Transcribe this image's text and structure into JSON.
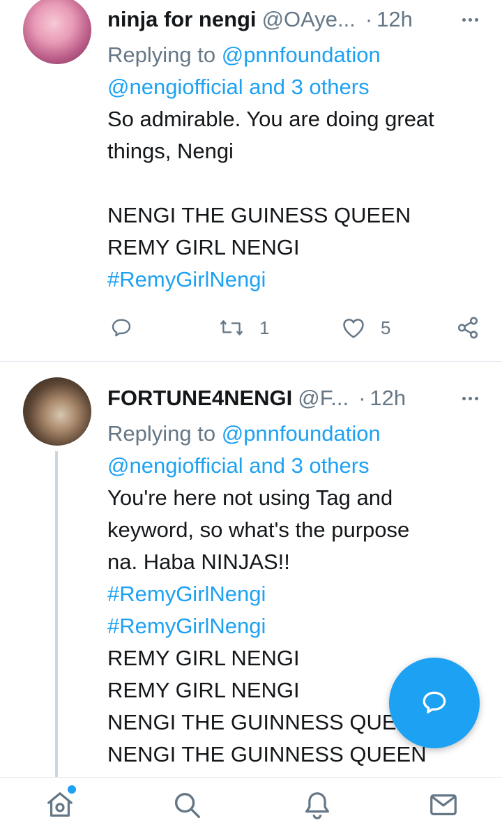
{
  "tweets": [
    {
      "display_name": "ninja for nengi",
      "handle": "@OAye...",
      "separator": "·",
      "time": "12h",
      "replying_prefix": "Replying to",
      "mention_primary": "@pnnfoundation",
      "mention_secondary": "@nengiofficial and 3 others",
      "lines": [
        {
          "type": "text",
          "value": "So admirable. You are doing great"
        },
        {
          "type": "text",
          "value": "things, Nengi"
        },
        {
          "type": "blank",
          "value": ""
        },
        {
          "type": "text",
          "value": "NENGI THE GUINESS QUEEN"
        },
        {
          "type": "text",
          "value": "REMY GIRL NENGI"
        },
        {
          "type": "hashtag",
          "value": "#RemyGirlNengi"
        }
      ],
      "actions": {
        "reply_icon": "reply-icon",
        "retweet_icon": "retweet-icon",
        "retweet_count": "1",
        "like_icon": "heart-icon",
        "like_count": "5",
        "share_icon": "share-icon"
      }
    },
    {
      "display_name": "FORTUNE4NENGI",
      "handle": "@F...",
      "separator": "·",
      "time": "12h",
      "replying_prefix": "Replying to",
      "mention_primary": "@pnnfoundation",
      "mention_secondary": "@nengiofficial and 3 others",
      "lines": [
        {
          "type": "text",
          "value": "You're here not using Tag and"
        },
        {
          "type": "text",
          "value": "keyword, so what's the purpose"
        },
        {
          "type": "text",
          "value": "na. Haba NINJAS!!"
        },
        {
          "type": "hashtag",
          "value": "#RemyGirlNengi"
        },
        {
          "type": "hashtag",
          "value": "#RemyGirlNengi"
        },
        {
          "type": "text",
          "value": "REMY GIRL NENGI"
        },
        {
          "type": "text",
          "value": "REMY GIRL NENGI"
        },
        {
          "type": "text",
          "value": "NENGI THE GUINNESS QUEEN"
        },
        {
          "type": "text",
          "value": "NENGI THE GUINNESS QUEEN"
        }
      ]
    }
  ],
  "fab": {
    "icon": "compose-reply-icon"
  },
  "bottom_nav": [
    {
      "icon": "home-icon",
      "has_badge": true
    },
    {
      "icon": "search-icon"
    },
    {
      "icon": "bell-icon"
    },
    {
      "icon": "mail-icon"
    }
  ],
  "colors": {
    "accent": "#1da1f2",
    "secondary_text": "#657786",
    "primary_text": "#14171a",
    "divider": "#e1e8ed"
  }
}
